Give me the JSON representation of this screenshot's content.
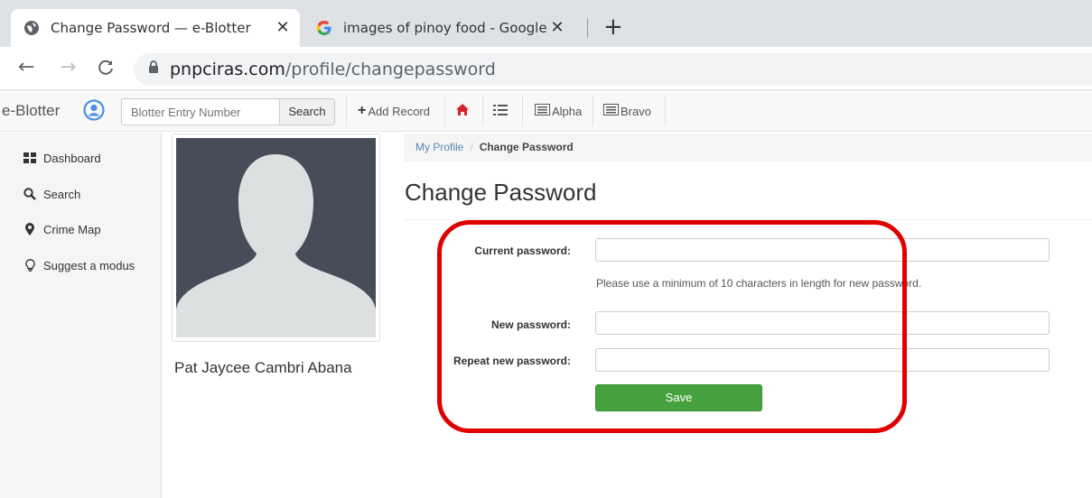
{
  "browser": {
    "tabs": [
      {
        "title": "Change Password — e-Blotter",
        "close": "✕",
        "active": true
      },
      {
        "title": "images of pinoy food - Google Se",
        "close": "✕",
        "active": false
      }
    ],
    "new_tab": "+",
    "url_host": "pnpciras.com",
    "url_path": "/profile/changepassword"
  },
  "navbar": {
    "brand": "e-Blotter",
    "search_placeholder": "Blotter Entry Number",
    "search_button": "Search",
    "add_record": "Add Record",
    "alpha": "Alpha",
    "bravo": "Bravo"
  },
  "sidebar": {
    "items": [
      {
        "label": "Dashboard",
        "icon": "grid-icon"
      },
      {
        "label": "Search",
        "icon": "search-icon"
      },
      {
        "label": "Crime Map",
        "icon": "map-marker-icon"
      },
      {
        "label": "Suggest a modus",
        "icon": "lightbulb-icon"
      }
    ]
  },
  "profile": {
    "name": "Pat Jaycee Cambri Abana"
  },
  "breadcrumb": {
    "parent": "My Profile",
    "separator": "/",
    "current": "Change Password"
  },
  "page": {
    "title": "Change Password"
  },
  "form": {
    "current_password_label": "Current password:",
    "help_text": "Please use a minimum of 10 characters in length for new password.",
    "new_password_label": "New password:",
    "repeat_password_label": "Repeat new password:",
    "save_label": "Save"
  },
  "colors": {
    "highlight": "#e00000",
    "save_button": "#46a23f",
    "link": "#5a87b5",
    "avatar_bg": "#474c59"
  }
}
